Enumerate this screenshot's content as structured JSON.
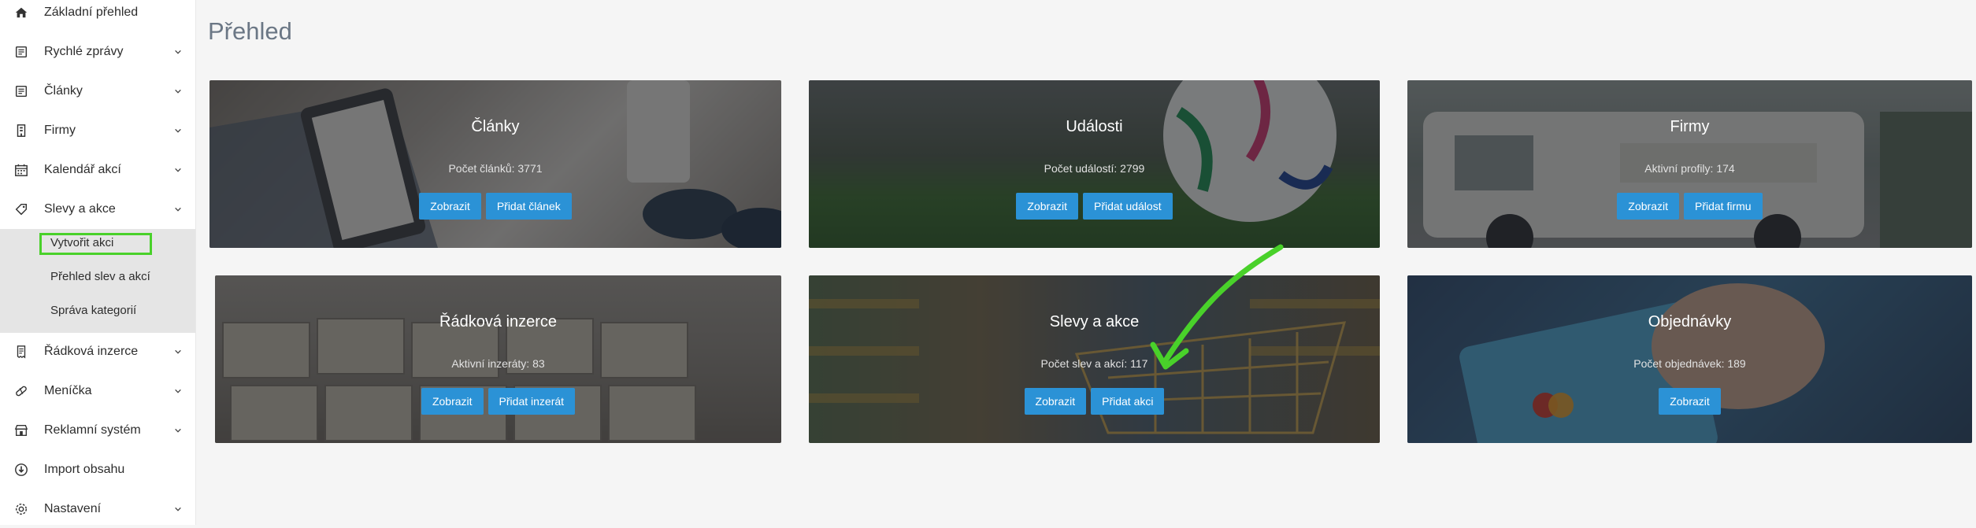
{
  "sidebar": {
    "items": [
      {
        "label": "Základní přehled",
        "icon": "home-icon"
      },
      {
        "label": "Rychlé zprávy",
        "icon": "newspaper-icon"
      },
      {
        "label": "Články",
        "icon": "newspaper-icon"
      },
      {
        "label": "Firmy",
        "icon": "building-icon"
      },
      {
        "label": "Kalendář akcí",
        "icon": "calendar-icon"
      },
      {
        "label": "Slevy a akce",
        "icon": "tag-icon"
      },
      {
        "label": "Řádková inzerce",
        "icon": "receipt-icon"
      },
      {
        "label": "Meníčka",
        "icon": "pill-icon"
      },
      {
        "label": "Reklamní systém",
        "icon": "store-icon"
      },
      {
        "label": "Import obsahu",
        "icon": "import-icon"
      },
      {
        "label": "Nastavení",
        "icon": "gear-icon"
      }
    ],
    "submenu": [
      {
        "label": "Vytvořit akci"
      },
      {
        "label": "Přehled slev a akcí"
      },
      {
        "label": "Správa kategorií"
      }
    ]
  },
  "main": {
    "title": "Přehled",
    "cards": [
      {
        "title": "Články",
        "stat": "Počet článků: 3771",
        "buttons": [
          "Zobrazit",
          "Přidat článek"
        ]
      },
      {
        "title": "Události",
        "stat": "Počet událostí: 2799",
        "buttons": [
          "Zobrazit",
          "Přidat událost"
        ]
      },
      {
        "title": "Firmy",
        "stat": "Aktivní profily: 174",
        "buttons": [
          "Zobrazit",
          "Přidat firmu"
        ]
      },
      {
        "title": "Řádková inzerce",
        "stat": "Aktivní inzeráty: 83",
        "buttons": [
          "Zobrazit",
          "Přidat inzerát"
        ]
      },
      {
        "title": "Slevy a akce",
        "stat": "Počet slev a akcí: 117",
        "buttons": [
          "Zobrazit",
          "Přidat akci"
        ]
      },
      {
        "title": "Objednávky",
        "stat": "Počet objednávek: 189",
        "buttons": [
          "Zobrazit"
        ]
      }
    ]
  },
  "colors": {
    "button": "#2b92d6",
    "highlight": "#49d12a",
    "annotation_arrow": "#49d12a"
  }
}
